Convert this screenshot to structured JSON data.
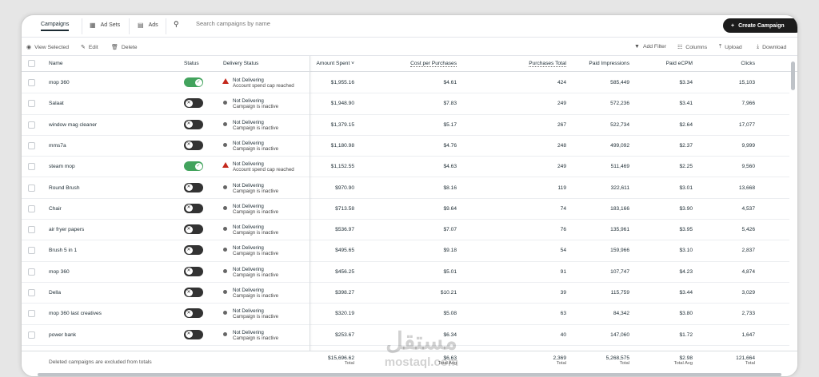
{
  "tabs": [
    {
      "label": "Campaigns",
      "icon": "folder-icon"
    },
    {
      "label": "Ad Sets",
      "icon": "grid-icon"
    },
    {
      "label": "Ads",
      "icon": "document-icon"
    }
  ],
  "search": {
    "placeholder": "Search campaigns by name"
  },
  "create_button": "Create Campaign",
  "actions": {
    "view_selected": "View Selected",
    "edit": "Edit",
    "delete": "Delete",
    "add_filter": "Add Filter",
    "columns": "Columns",
    "upload": "Upload",
    "download": "Download"
  },
  "columns": {
    "name": "Name",
    "status": "Status",
    "delivery": "Delivery Status",
    "amount": "Amount Spent",
    "cpp": "Cost per Purchases",
    "purchases": "Purchases Total",
    "impressions": "Paid Impressions",
    "ecpm": "Paid eCPM",
    "clicks": "Clicks"
  },
  "rows": [
    {
      "name": "mop 360",
      "on": true,
      "d1": "Not Delivering",
      "d2": "Account spend cap reached",
      "warn": true,
      "amount": "$1,955.16",
      "cpp": "$4.61",
      "purchases": "424",
      "impressions": "585,449",
      "ecpm": "$3.34",
      "clicks": "15,103"
    },
    {
      "name": "Salaat",
      "on": false,
      "d1": "Not Delivering",
      "d2": "Campaign is inactive",
      "warn": false,
      "amount": "$1,948.90",
      "cpp": "$7.83",
      "purchases": "249",
      "impressions": "572,236",
      "ecpm": "$3.41",
      "clicks": "7,966"
    },
    {
      "name": "window mag cleaner",
      "on": false,
      "d1": "Not Delivering",
      "d2": "Campaign is inactive",
      "warn": false,
      "amount": "$1,379.15",
      "cpp": "$5.17",
      "purchases": "267",
      "impressions": "522,734",
      "ecpm": "$2.64",
      "clicks": "17,077"
    },
    {
      "name": "mms7a",
      "on": false,
      "d1": "Not Delivering",
      "d2": "Campaign is inactive",
      "warn": false,
      "amount": "$1,180.98",
      "cpp": "$4.76",
      "purchases": "248",
      "impressions": "499,092",
      "ecpm": "$2.37",
      "clicks": "9,999"
    },
    {
      "name": "steam mop",
      "on": true,
      "d1": "Not Delivering",
      "d2": "Account spend cap reached",
      "warn": true,
      "amount": "$1,152.55",
      "cpp": "$4.63",
      "purchases": "249",
      "impressions": "511,469",
      "ecpm": "$2.25",
      "clicks": "9,560"
    },
    {
      "name": "Round Brush",
      "on": false,
      "d1": "Not Delivering",
      "d2": "Campaign is inactive",
      "warn": false,
      "amount": "$970.90",
      "cpp": "$8.16",
      "purchases": "119",
      "impressions": "322,611",
      "ecpm": "$3.01",
      "clicks": "13,668"
    },
    {
      "name": "Chair",
      "on": false,
      "d1": "Not Delivering",
      "d2": "Campaign is inactive",
      "warn": false,
      "amount": "$713.58",
      "cpp": "$9.64",
      "purchases": "74",
      "impressions": "183,166",
      "ecpm": "$3.90",
      "clicks": "4,537"
    },
    {
      "name": "air fryer papers",
      "on": false,
      "d1": "Not Delivering",
      "d2": "Campaign is inactive",
      "warn": false,
      "amount": "$536.97",
      "cpp": "$7.07",
      "purchases": "76",
      "impressions": "135,961",
      "ecpm": "$3.95",
      "clicks": "5,426"
    },
    {
      "name": "Brush 5 in 1",
      "on": false,
      "d1": "Not Delivering",
      "d2": "Campaign is inactive",
      "warn": false,
      "amount": "$495.65",
      "cpp": "$9.18",
      "purchases": "54",
      "impressions": "159,966",
      "ecpm": "$3.10",
      "clicks": "2,837"
    },
    {
      "name": "mop 360",
      "on": false,
      "d1": "Not Delivering",
      "d2": "Campaign is inactive",
      "warn": false,
      "amount": "$456.25",
      "cpp": "$5.01",
      "purchases": "91",
      "impressions": "107,747",
      "ecpm": "$4.23",
      "clicks": "4,874"
    },
    {
      "name": "Della",
      "on": false,
      "d1": "Not Delivering",
      "d2": "Campaign is inactive",
      "warn": false,
      "amount": "$398.27",
      "cpp": "$10.21",
      "purchases": "39",
      "impressions": "115,759",
      "ecpm": "$3.44",
      "clicks": "3,029"
    },
    {
      "name": "mop 360 last creatives",
      "on": false,
      "d1": "Not Delivering",
      "d2": "Campaign is inactive",
      "warn": false,
      "amount": "$320.19",
      "cpp": "$5.08",
      "purchases": "63",
      "impressions": "84,342",
      "ecpm": "$3.80",
      "clicks": "2,733"
    },
    {
      "name": "power bank",
      "on": false,
      "d1": "Not Delivering",
      "d2": "Campaign is inactive",
      "warn": false,
      "amount": "$253.67",
      "cpp": "$6.34",
      "purchases": "40",
      "impressions": "147,060",
      "ecpm": "$1.72",
      "clicks": "1,647"
    }
  ],
  "footer": {
    "note": "Deleted campaigns are excluded from totals",
    "amount": "$15,696.62",
    "amount_sub": "Total",
    "cpp": "$6.63",
    "cpp_sub": "Total Avg",
    "purchases": "2,369",
    "purchases_sub": "Total",
    "impressions": "5,268,575",
    "impressions_sub": "Total",
    "ecpm": "$2.98",
    "ecpm_sub": "Total Avg",
    "clicks": "121,664",
    "clicks_sub": "Total"
  },
  "watermark": {
    "arabic": "مستقل",
    "latin": "mostaql.com"
  }
}
